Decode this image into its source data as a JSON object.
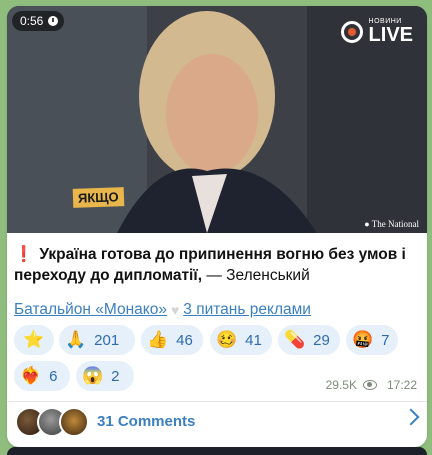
{
  "video": {
    "duration": "0:56",
    "brand_small": "НОВИНИ",
    "brand_big": "LIVE",
    "caption": "ЯКЩО",
    "watermark": "The National"
  },
  "post": {
    "excl": "❗",
    "lead": "Україна готова до припинення вогню без умов і переходу до дипломатії,",
    "tail": " — Зеленський"
  },
  "links": {
    "channel": "Батальйон «Монако»",
    "ads": "3 питань реклами"
  },
  "reactions": [
    {
      "emoji": "⭐",
      "count": ""
    },
    {
      "emoji": "🙏",
      "count": "201"
    },
    {
      "emoji": "👍",
      "count": "46"
    },
    {
      "emoji": "🥴",
      "count": "41"
    },
    {
      "emoji": "💊",
      "count": "29"
    },
    {
      "emoji": "🤬",
      "count": "7"
    },
    {
      "emoji": "❤️‍🔥",
      "count": "6"
    },
    {
      "emoji": "😱",
      "count": "2"
    }
  ],
  "meta": {
    "views": "29.5K",
    "time": "17:22"
  },
  "comments": {
    "label": "31 Comments"
  },
  "colors": {
    "accent": "#3a7fc1",
    "chip_bg": "#e6f0fa",
    "wallpaper": "#8fbd7e"
  }
}
